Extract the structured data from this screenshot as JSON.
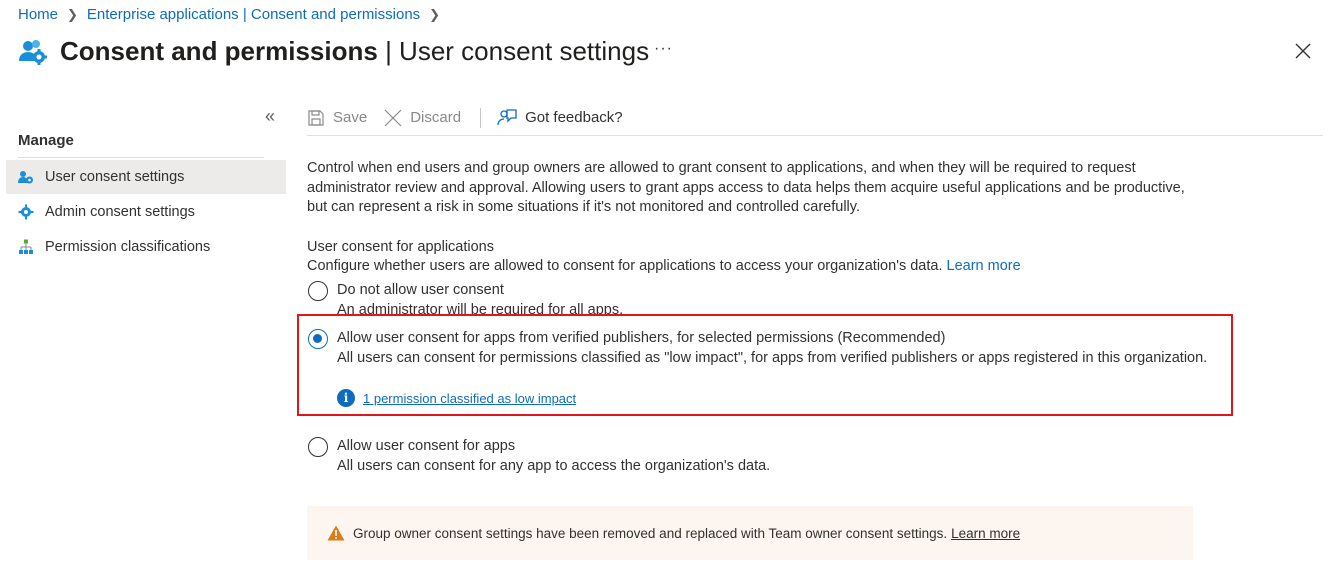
{
  "breadcrumb": {
    "home": "Home",
    "parent": "Enterprise applications | Consent and permissions"
  },
  "header": {
    "title_main": "Consent and permissions",
    "title_sub": "| User consent settings",
    "more": "···"
  },
  "sidebar": {
    "manage_label": "Manage",
    "items": [
      {
        "label": "User consent settings",
        "icon": "users-gear-icon",
        "active": true
      },
      {
        "label": "Admin consent settings",
        "icon": "gear-icon",
        "active": false
      },
      {
        "label": "Permission classifications",
        "icon": "hierarchy-icon",
        "active": false
      }
    ]
  },
  "toolbar": {
    "save_label": "Save",
    "discard_label": "Discard",
    "feedback_label": "Got feedback?"
  },
  "main": {
    "description": "Control when end users and group owners are allowed to grant consent to applications, and when they will be required to request administrator review and approval. Allowing users to grant apps access to data helps them acquire useful applications and be productive, but can represent a risk in some situations if it's not monitored and controlled carefully.",
    "section_title": "User consent for applications",
    "section_desc": "Configure whether users are allowed to consent for applications to access your organization's data.",
    "section_learn_more": "Learn more",
    "options": [
      {
        "label": "Do not allow user consent",
        "sub": "An administrator will be required for all apps.",
        "checked": false
      },
      {
        "label": "Allow user consent for apps from verified publishers, for selected permissions (Recommended)",
        "sub": "All users can consent for permissions classified as \"low impact\", for apps from verified publishers or apps registered in this organization.",
        "checked": true
      },
      {
        "label": "Allow user consent for apps",
        "sub": "All users can consent for any app to access the organization's data.",
        "checked": false
      }
    ],
    "info_link": "1 permission classified as low impact",
    "warning_text": "Group owner consent settings have been removed and replaced with Team owner consent settings.",
    "warning_learn_more": "Learn more"
  },
  "colors": {
    "accent": "#0f6cbd",
    "highlight": "#e0161d",
    "warning_bg": "#fdf6f0",
    "warning_icon": "#d97c1c"
  }
}
